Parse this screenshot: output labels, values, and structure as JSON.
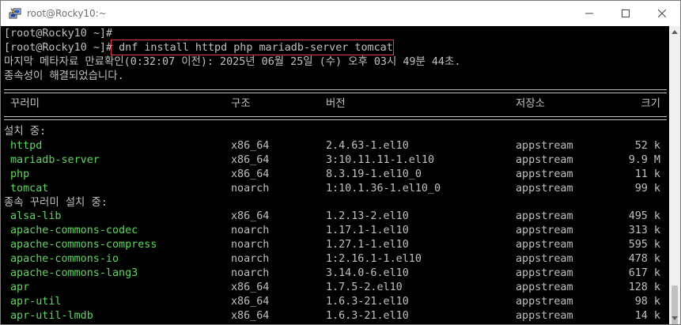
{
  "window": {
    "title": "root@Rocky10:~",
    "icon": "putty-icon",
    "controls": [
      "minimize-icon",
      "maximize-icon",
      "close-icon"
    ]
  },
  "terminal": {
    "prompt_line_1": "[root@Rocky10 ~]#",
    "prompt_line_2": "[root@Rocky10 ~]#",
    "command": " dnf install httpd php mariadb-server tomcat",
    "meta_line": "마지막 메타자료 만료확인(0:32:07 이전): 2025년 06월 25일 (수) 오후 03시 49분 44초.",
    "deps_line": "종속성이 해결되었습니다.",
    "highlight_color": "#e23b3b",
    "package_color": "#5fd75f",
    "headers": {
      "package": "꾸러미",
      "arch": "구조",
      "version": "버전",
      "repo": "저장소",
      "size": "크기"
    },
    "sections": [
      {
        "title": "설치 중:",
        "rows": [
          {
            "name": "httpd",
            "arch": "x86_64",
            "version": "2.4.63-1.el10",
            "repo": "appstream",
            "size": "52 k"
          },
          {
            "name": "mariadb-server",
            "arch": "x86_64",
            "version": "3:10.11.11-1.el10",
            "repo": "appstream",
            "size": "9.9 M"
          },
          {
            "name": "php",
            "arch": "x86_64",
            "version": "8.3.19-1.el10_0",
            "repo": "appstream",
            "size": "11 k"
          },
          {
            "name": "tomcat",
            "arch": "noarch",
            "version": "1:10.1.36-1.el10_0",
            "repo": "appstream",
            "size": "99 k"
          }
        ]
      },
      {
        "title": "종속 꾸러미 설치 중:",
        "rows": [
          {
            "name": "alsa-lib",
            "arch": "x86_64",
            "version": "1.2.13-2.el10",
            "repo": "appstream",
            "size": "495 k"
          },
          {
            "name": "apache-commons-codec",
            "arch": "noarch",
            "version": "1.17.1-1.el10",
            "repo": "appstream",
            "size": "313 k"
          },
          {
            "name": "apache-commons-compress",
            "arch": "noarch",
            "version": "1.27.1-1.el10",
            "repo": "appstream",
            "size": "595 k"
          },
          {
            "name": "apache-commons-io",
            "arch": "noarch",
            "version": "1:2.16.1-1.el10",
            "repo": "appstream",
            "size": "478 k"
          },
          {
            "name": "apache-commons-lang3",
            "arch": "noarch",
            "version": "3.14.0-6.el10",
            "repo": "appstream",
            "size": "617 k"
          },
          {
            "name": "apr",
            "arch": "x86_64",
            "version": "1.7.5-2.el10",
            "repo": "appstream",
            "size": "128 k"
          },
          {
            "name": "apr-util",
            "arch": "x86_64",
            "version": "1.6.3-21.el10",
            "repo": "appstream",
            "size": "98 k"
          },
          {
            "name": "apr-util-lmdb",
            "arch": "x86_64",
            "version": "1.6.3-21.el10",
            "repo": "appstream",
            "size": "14 k"
          }
        ]
      }
    ]
  }
}
